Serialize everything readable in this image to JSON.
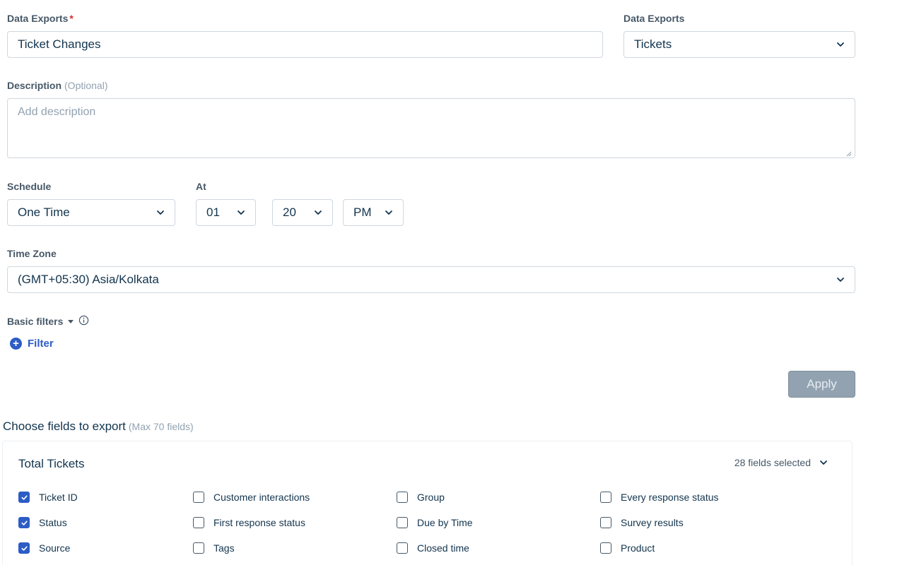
{
  "form": {
    "name": {
      "label": "Data Exports",
      "required_mark": "*",
      "value": "Ticket Changes"
    },
    "type": {
      "label": "Data Exports",
      "value": "Tickets"
    },
    "description": {
      "label": "Description",
      "optional": "(Optional)",
      "placeholder": "Add description"
    },
    "schedule": {
      "label": "Schedule",
      "value": "One Time"
    },
    "at": {
      "label": "At",
      "hour": "01",
      "minute": "20",
      "meridiem": "PM"
    },
    "timezone": {
      "label": "Time Zone",
      "value": "(GMT+05:30) Asia/Kolkata"
    },
    "basic_filters": {
      "label": "Basic filters"
    },
    "filter_link": {
      "label": "Filter"
    },
    "apply_button": {
      "label": "Apply"
    }
  },
  "fields_section": {
    "title": "Choose fields to export",
    "max_note": "(Max 70 fields)",
    "panel_title": "Total Tickets",
    "selected_count": "28 fields selected",
    "columns": [
      [
        {
          "label": "Ticket ID",
          "checked": true
        },
        {
          "label": "Status",
          "checked": true
        },
        {
          "label": "Source",
          "checked": true
        }
      ],
      [
        {
          "label": "Customer interactions",
          "checked": false
        },
        {
          "label": "First response status",
          "checked": false
        },
        {
          "label": "Tags",
          "checked": false
        }
      ],
      [
        {
          "label": "Group",
          "checked": false
        },
        {
          "label": "Due by Time",
          "checked": false
        },
        {
          "label": "Closed time",
          "checked": false
        }
      ],
      [
        {
          "label": "Every response status",
          "checked": false
        },
        {
          "label": "Survey results",
          "checked": false
        },
        {
          "label": "Product",
          "checked": false
        }
      ]
    ]
  },
  "colors": {
    "accent": "#2c5cc5",
    "required": "#d72d30",
    "disabled_button": "#92a2b1"
  },
  "icons": {
    "select": "chevron-down-icon",
    "info": "info-icon",
    "add": "plus-circle-icon",
    "check": "check-icon"
  }
}
